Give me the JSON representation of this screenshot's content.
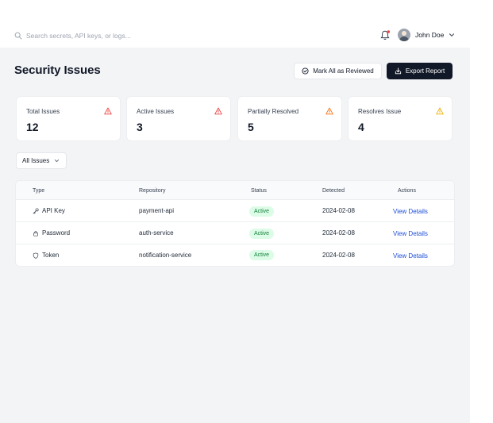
{
  "search": {
    "placeholder": "Search secrets, API keys, or logs..."
  },
  "header": {
    "user_name": "John Doe",
    "notification_dot_color": "#ef4444"
  },
  "page": {
    "title": "Security Issues"
  },
  "actions": {
    "mark_reviewed_label": "Mark All as Reviewed",
    "export_label": "Export Report"
  },
  "stats": [
    {
      "label": "Total Issues",
      "value": "12",
      "icon": "warning-triangle-icon",
      "icon_color": "#ef4444"
    },
    {
      "label": "Active Issues",
      "value": "3",
      "icon": "warning-triangle-icon",
      "icon_color": "#ef4444"
    },
    {
      "label": "Partially Resolved",
      "value": "5",
      "icon": "warning-triangle-icon",
      "icon_color": "#f97316"
    },
    {
      "label": "Resolves Issue",
      "value": "4",
      "icon": "warning-triangle-icon",
      "icon_color": "#eab308"
    }
  ],
  "filter": {
    "selected": "All Issues"
  },
  "table": {
    "columns": [
      "Type",
      "Repository",
      "Status",
      "Detected",
      "Actions"
    ],
    "rows": [
      {
        "type": "API Key",
        "type_icon": "key-icon",
        "repository": "payment-api",
        "status": "Active",
        "detected": "2024-02-08",
        "action": "View Details"
      },
      {
        "type": "Password",
        "type_icon": "lock-icon",
        "repository": "auth-service",
        "status": "Active",
        "detected": "2024-02-08",
        "action": "View Details"
      },
      {
        "type": "Token",
        "type_icon": "shield-icon",
        "repository": "notification-service",
        "status": "Active",
        "detected": "2024-02-08",
        "action": "View Details"
      }
    ]
  },
  "colors": {
    "primary_button": "#111827",
    "link": "#1d4ed8",
    "active_badge_bg": "#dcfce7",
    "active_badge_text": "#15803d",
    "background": "#f3f4f6"
  }
}
